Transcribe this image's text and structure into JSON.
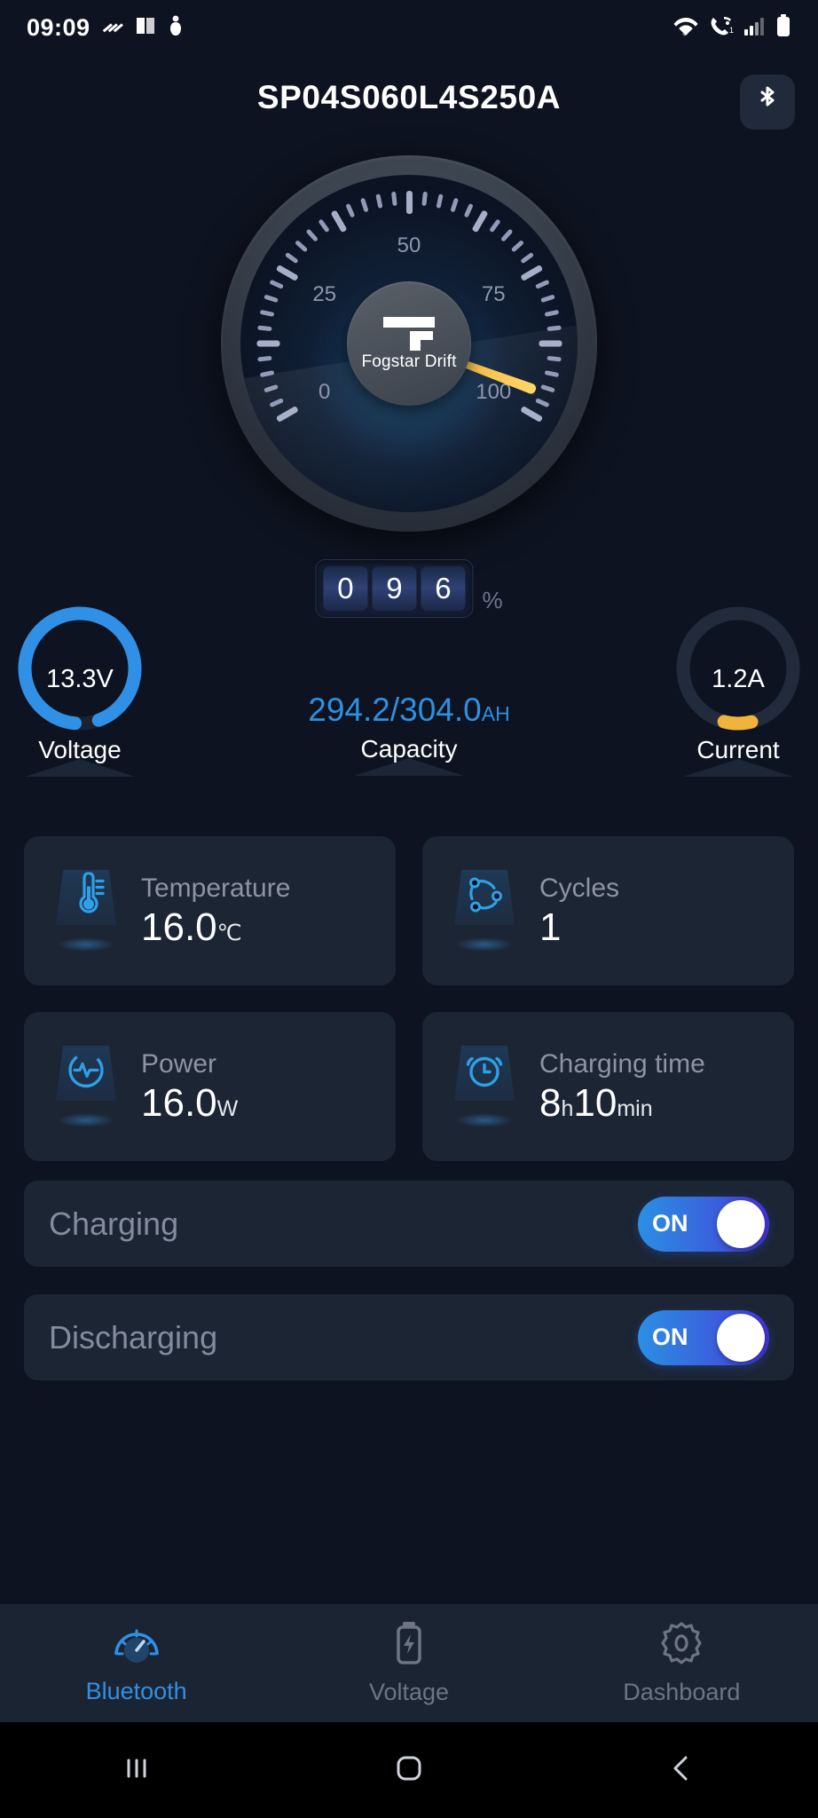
{
  "status_bar": {
    "time": "09:09",
    "left_icons": [
      "vibrate-icon",
      "screenshot-icon",
      "person-icon"
    ],
    "right_icons": [
      "wifi-icon",
      "call-forward-icon",
      "signal-icon",
      "battery-icon"
    ]
  },
  "header": {
    "title": "SP04S060L4S250A",
    "bluetooth_icon": "bluetooth-icon"
  },
  "gauge": {
    "brand": "Fogstar Drift",
    "tick_labels": [
      "0",
      "25",
      "50",
      "75",
      "100"
    ],
    "min": 0,
    "max": 100,
    "soc_digits": [
      "0",
      "9",
      "6"
    ],
    "soc_unit": "%",
    "soc_value": 96
  },
  "metrics_row": {
    "voltage": {
      "value": "13.3V",
      "label": "Voltage",
      "ring_percent": 93,
      "ring_color": "#2f90e6"
    },
    "capacity": {
      "value": "294.2/304.0",
      "unit": "AH",
      "label": "Capacity",
      "color": "#2f8fe0"
    },
    "current": {
      "value": "1.2A",
      "label": "Current",
      "ring_percent": 8,
      "ring_color": "#f2b33d"
    }
  },
  "cards": [
    {
      "label": "Temperature",
      "value": "16.0",
      "unit": "℃",
      "icon": "thermometer-icon"
    },
    {
      "label": "Cycles",
      "value": "1",
      "unit": "",
      "icon": "cycles-icon"
    },
    {
      "label": "Power",
      "value": "16.0",
      "unit": "W",
      "icon": "power-pulse-icon"
    },
    {
      "label": "Charging time",
      "value": "8",
      "unit": "h",
      "value2": "10",
      "unit2": "min",
      "icon": "alarm-clock-icon"
    }
  ],
  "toggles": [
    {
      "label": "Charging",
      "state": "ON",
      "on": true
    },
    {
      "label": "Discharging",
      "state": "ON",
      "on": true
    }
  ],
  "bottom_nav": [
    {
      "label": "Bluetooth",
      "icon": "gauge-icon",
      "active": true
    },
    {
      "label": "Voltage",
      "icon": "battery-bolt-icon",
      "active": false
    },
    {
      "label": "Dashboard",
      "icon": "gear-icon",
      "active": false
    }
  ],
  "android_nav": [
    "recents-icon",
    "home-icon",
    "back-icon"
  ],
  "colors": {
    "background": "#0d1320",
    "card": "#1c2534",
    "accent_blue": "#2f90e6",
    "accent_amber": "#f2b33d",
    "nav_bar": "#1b2433"
  }
}
